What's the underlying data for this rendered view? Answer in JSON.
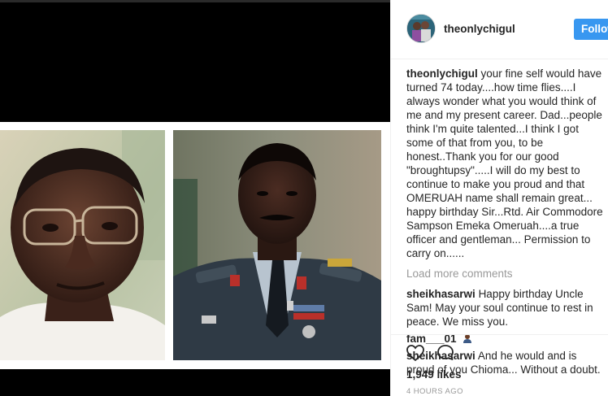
{
  "post": {
    "username": "theonlychigul",
    "follow_label": "Follow",
    "caption_username": "theonlychigul",
    "caption_text": "your fine self would have turned 74 today....how time flies....I always wonder what you would think of me and my present career. Dad...people think I'm quite talented...I think I got some of that from you, to be honest..Thank you for our good \"broughtupsy\".....I will do my best to continue to make you proud and that OMERUAH name shall remain great... happy birthday Sir...Rtd. Air Commodore Sampson Emeka Omeruah....a true officer and gentleman... Permission to carry on......",
    "load_more": "Load more comments",
    "comments": [
      {
        "username": "sheikhasarwi",
        "text": "Happy birthday Uncle Sam! May your soul continue to rest in peace. We miss you."
      },
      {
        "username": "fam___01",
        "text": ""
      },
      {
        "username": "sheikhasarwi",
        "text": "And he would and is proud of you Chioma... Without a doubt."
      }
    ],
    "likes": "1,949 likes",
    "time": "4 HOURS AGO"
  },
  "icons": {
    "like": "heart-icon",
    "comment": "comment-bubble-icon",
    "emoji": "person-emoji-icon"
  },
  "colors": {
    "accent": "#3897f0",
    "text": "#262626",
    "muted": "#999999"
  }
}
